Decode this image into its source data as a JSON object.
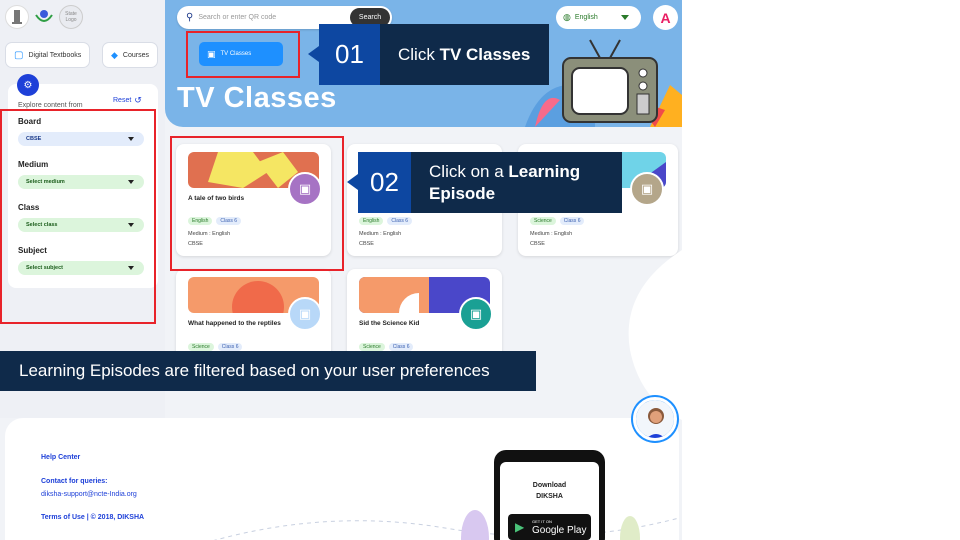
{
  "header": {
    "logo_text": "State Logo",
    "search": {
      "placeholder": "Search or enter QR code",
      "button": "Search"
    },
    "language": "English",
    "avatar_initial": "A"
  },
  "nav_tabs": [
    {
      "label": "Digital Textbooks",
      "icon": "book-icon"
    },
    {
      "label": "Courses",
      "icon": "graduation-cap-icon"
    },
    {
      "label": "TV Classes",
      "icon": "tv-icon"
    }
  ],
  "hero": {
    "title": "TV Classes"
  },
  "filters": {
    "header": "Explore content from",
    "reset": "Reset",
    "board": {
      "label": "Board",
      "value": "CBSE"
    },
    "medium": {
      "label": "Medium",
      "value": "Select medium"
    },
    "class": {
      "label": "Class",
      "value": "Select class"
    },
    "subject": {
      "label": "Subject",
      "value": "Select subject"
    }
  },
  "cards": [
    {
      "title": "A tale of two birds",
      "tags": [
        "English",
        "Class 6"
      ],
      "medium": "Medium : English",
      "board": "CBSE"
    },
    {
      "title": "",
      "tags": [
        "English",
        "Class 6"
      ],
      "medium": "Medium : English",
      "board": "CBSE"
    },
    {
      "title": "",
      "tags": [
        "Science",
        "Class 6"
      ],
      "medium": "Medium : English",
      "board": "CBSE"
    },
    {
      "title": "What happened to the reptiles",
      "tags": [
        "Science",
        "Class 6"
      ]
    },
    {
      "title": "Sid the Science Kid",
      "tags": [
        "Science",
        "Class 6"
      ]
    }
  ],
  "callouts": {
    "step1": {
      "number": "01",
      "text_prefix": "Click ",
      "text_bold": "TV Classes"
    },
    "step2": {
      "number": "02",
      "text_prefix": "Click on a ",
      "text_bold": "Learning Episode"
    }
  },
  "info_bar": "Learning Episodes are filtered based on your user preferences",
  "footer": {
    "help_center": "Help Center",
    "contact_label": "Contact for queries:",
    "contact_email": "diksha-support@ncte-India.org",
    "terms": "Terms of Use | © 2018, DIKSHA",
    "download_title": "Download",
    "download_brand": "DIKSHA",
    "store_small": "GET IT ON",
    "store_name": "Google Play"
  },
  "colors": {
    "accent": "#1e90ff",
    "callout_dark": "#0f2a4a",
    "callout_num": "#0d47a1",
    "highlight": "#e8232a"
  }
}
